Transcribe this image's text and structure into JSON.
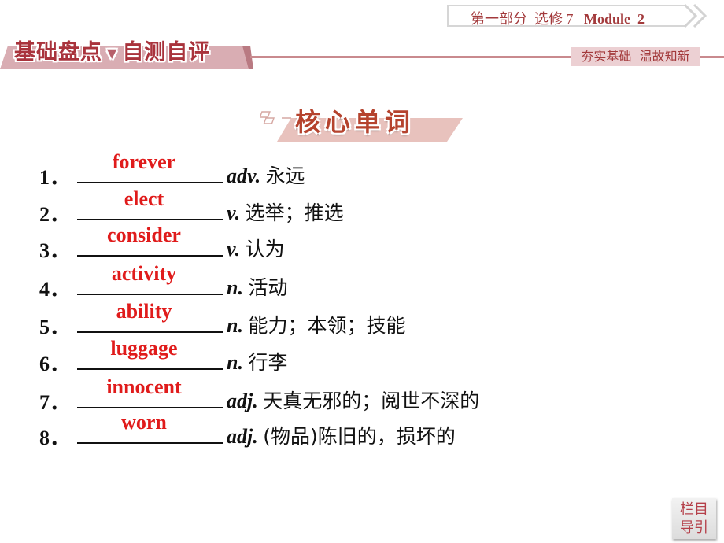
{
  "header": {
    "breadcrumb": {
      "part": "第一部分",
      "elective": "选修 7",
      "module": "Module  2"
    },
    "section_banner": {
      "left": "基础盘点",
      "separator_icon": "triangle-down-icon",
      "right": "自测自评"
    },
    "tagline": "夯实基础  温故知新"
  },
  "section": {
    "title": "核心单词"
  },
  "vocab": [
    {
      "num": "1．",
      "answer": "forever",
      "pos": "adv.",
      "meaning": "永远"
    },
    {
      "num": "2．",
      "answer": "elect",
      "pos": "v.",
      "meaning": "选举；推选"
    },
    {
      "num": "3．",
      "answer": "consider",
      "pos": "v.",
      "meaning": "认为"
    },
    {
      "num": "4．",
      "answer": "activity",
      "pos": "n.",
      "meaning": "活动"
    },
    {
      "num": "5．",
      "answer": "ability",
      "pos": "n.",
      "meaning": "能力；本领；技能"
    },
    {
      "num": "6．",
      "answer": "luggage",
      "pos": "n.",
      "meaning": "行李"
    },
    {
      "num": "7．",
      "answer": "innocent",
      "pos": "adj.",
      "meaning": "天真无邪的；阅世不深的"
    },
    {
      "num": "8．",
      "answer": "worn",
      "pos": "adj.",
      "meaning": "(物品)陈旧的，损坏的"
    }
  ],
  "nav": {
    "line1": "栏目",
    "line2": "导引"
  },
  "colors": {
    "answer": "#e01b1b",
    "accent": "#a9333c",
    "banner_bg": "#d9adb3",
    "section_title": "#b5432e",
    "section_bg": "#e8c2bd"
  }
}
